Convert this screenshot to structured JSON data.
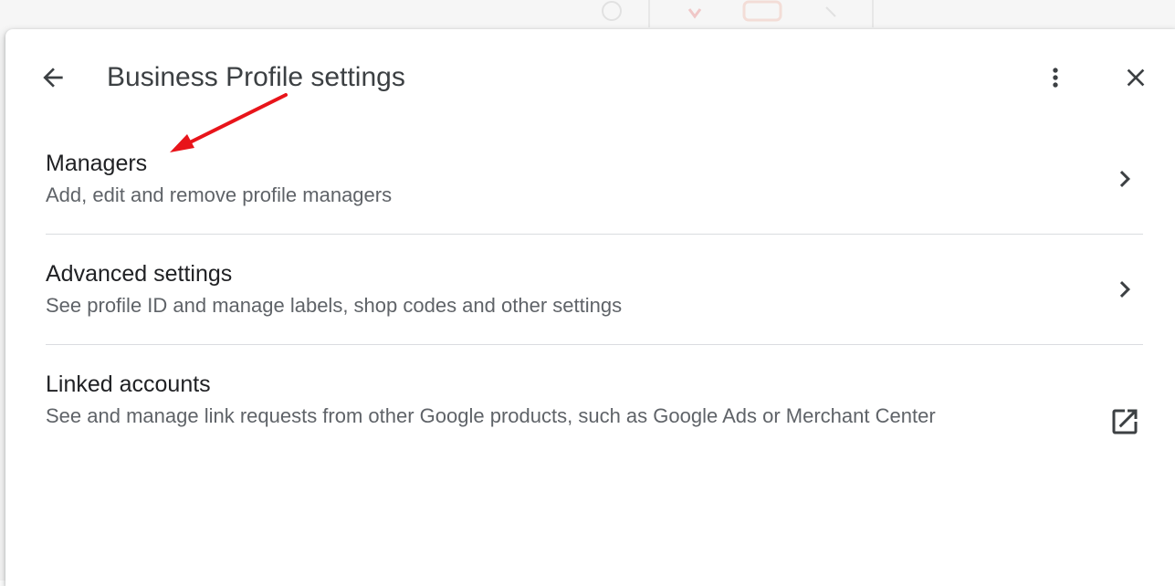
{
  "header": {
    "title": "Business Profile settings"
  },
  "icons": {
    "back": "arrow-back-icon",
    "more": "more-vert-icon",
    "close": "close-icon",
    "chevron": "chevron-right-icon",
    "external": "open-in-new-icon"
  },
  "items": [
    {
      "title": "Managers",
      "subtitle": "Add, edit and remove profile managers"
    },
    {
      "title": "Advanced settings",
      "subtitle": "See profile ID and manage labels, shop codes and other settings"
    },
    {
      "title": "Linked accounts",
      "subtitle": "See and manage link requests from other Google products, such as Google Ads or Merchant Center"
    }
  ],
  "colors": {
    "text_primary": "#202124",
    "text_secondary": "#5f6368",
    "divider": "#dadce0",
    "icon": "#3c4043",
    "annotation_arrow": "#e8141a"
  }
}
